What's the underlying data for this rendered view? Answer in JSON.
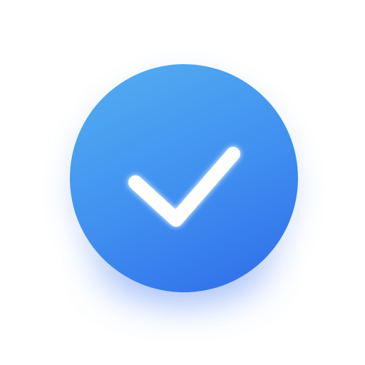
{
  "icon": {
    "name": "checkmark-badge-icon",
    "colors": {
      "gradient_start": "#54B0F0",
      "gradient_mid": "#3F8EF0",
      "gradient_end": "#2F6BE8",
      "check": "#FFFFFF",
      "background": "#FFFFFF"
    }
  }
}
